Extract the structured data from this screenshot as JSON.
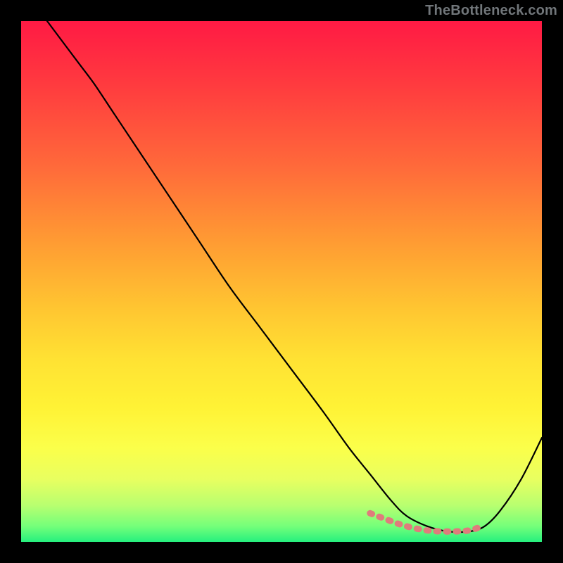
{
  "watermark": "TheBottleneck.com",
  "chart_data": {
    "type": "line",
    "title": "",
    "xlabel": "",
    "ylabel": "",
    "xlim": [
      0,
      100
    ],
    "ylim": [
      0,
      100
    ],
    "grid": false,
    "legend": false,
    "background": {
      "type": "vertical-gradient",
      "stops": [
        {
          "pos": 0,
          "color": "#ff1a44"
        },
        {
          "pos": 0.28,
          "color": "#ff6a3a"
        },
        {
          "pos": 0.55,
          "color": "#ffc531"
        },
        {
          "pos": 0.74,
          "color": "#fff235"
        },
        {
          "pos": 0.93,
          "color": "#b8ff70"
        },
        {
          "pos": 1.0,
          "color": "#26f07e"
        }
      ]
    },
    "series": [
      {
        "name": "bottleneck-curve",
        "color": "#000000",
        "x": [
          5,
          8,
          11,
          14,
          18,
          22,
          28,
          34,
          40,
          46,
          52,
          58,
          63,
          67,
          71,
          74,
          78,
          82,
          86,
          89,
          92,
          96,
          100
        ],
        "y": [
          100,
          96,
          92,
          88,
          82,
          76,
          67,
          58,
          49,
          41,
          33,
          25,
          18,
          13,
          8,
          5,
          3,
          2,
          2,
          3,
          6,
          12,
          20
        ]
      },
      {
        "name": "highlight-band",
        "color": "#e07a7a",
        "x": [
          67,
          71,
          74,
          78,
          82,
          86,
          89
        ],
        "y": [
          5.5,
          4.0,
          3.0,
          2.2,
          2.0,
          2.2,
          3.2
        ]
      }
    ],
    "annotations": []
  }
}
